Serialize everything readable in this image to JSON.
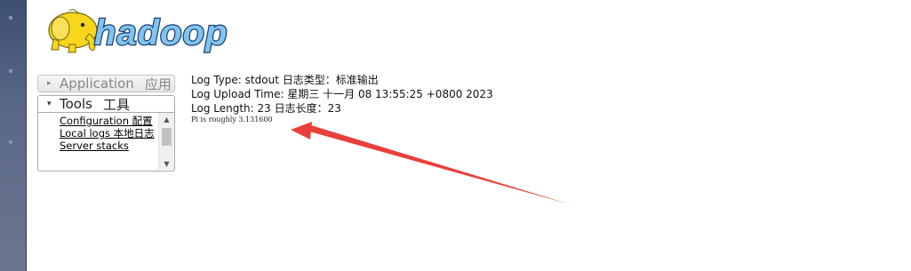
{
  "logo": {
    "text": "hadoop"
  },
  "sidebar": {
    "sections": [
      {
        "label": "Application",
        "label_cn": "应用"
      },
      {
        "label": "Tools",
        "label_cn": "工具"
      }
    ],
    "tools_links": [
      {
        "text": "Configuration 配置"
      },
      {
        "text": "Local logs 本地日志"
      },
      {
        "text": "Server stacks"
      }
    ]
  },
  "log": {
    "type_line": "Log Type: stdout 日志类型：标准输出",
    "upload_line": "Log Upload Time: 星期三 十一月 08 13:55:25 +0800 2023",
    "length_line": "Log Length: 23   日志长度：23",
    "output": "Pi is roughly 3.131600"
  },
  "colors": {
    "annotation_arrow": "#e8403a",
    "left_edge": "#3d4f73"
  }
}
